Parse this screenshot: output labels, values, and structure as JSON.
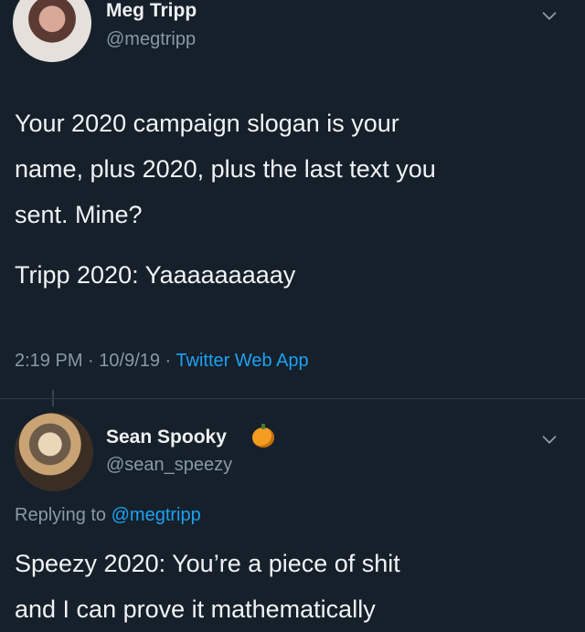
{
  "tweet": {
    "author_name": "Meg Tripp",
    "author_handle": "@megtripp",
    "text_lines": [
      "Your 2020 campaign slogan is your",
      "name, plus 2020, plus the last text you",
      "sent. Mine?"
    ],
    "text_second": "Tripp 2020: Yaaaaaaaaay",
    "time": "2:19 PM",
    "sep1": " · ",
    "date": "10/9/19",
    "sep2": " · ",
    "app": "Twitter Web App",
    "chevron_icon": "chevron-down-icon"
  },
  "reply": {
    "author_name": "Sean Spooky",
    "author_handle": "@sean_speezy",
    "name_emoji_icon": "pumpkin-icon",
    "replying_prefix": "Replying to ",
    "replying_to": "@megtripp",
    "text_lines": [
      "Speezy 2020: You’re a piece of shit",
      "and I can prove it mathematically"
    ],
    "chevron_icon": "chevron-down-icon"
  },
  "colors": {
    "background": "#15202b",
    "link": "#1da1f2",
    "secondary_text": "#8899a6"
  }
}
